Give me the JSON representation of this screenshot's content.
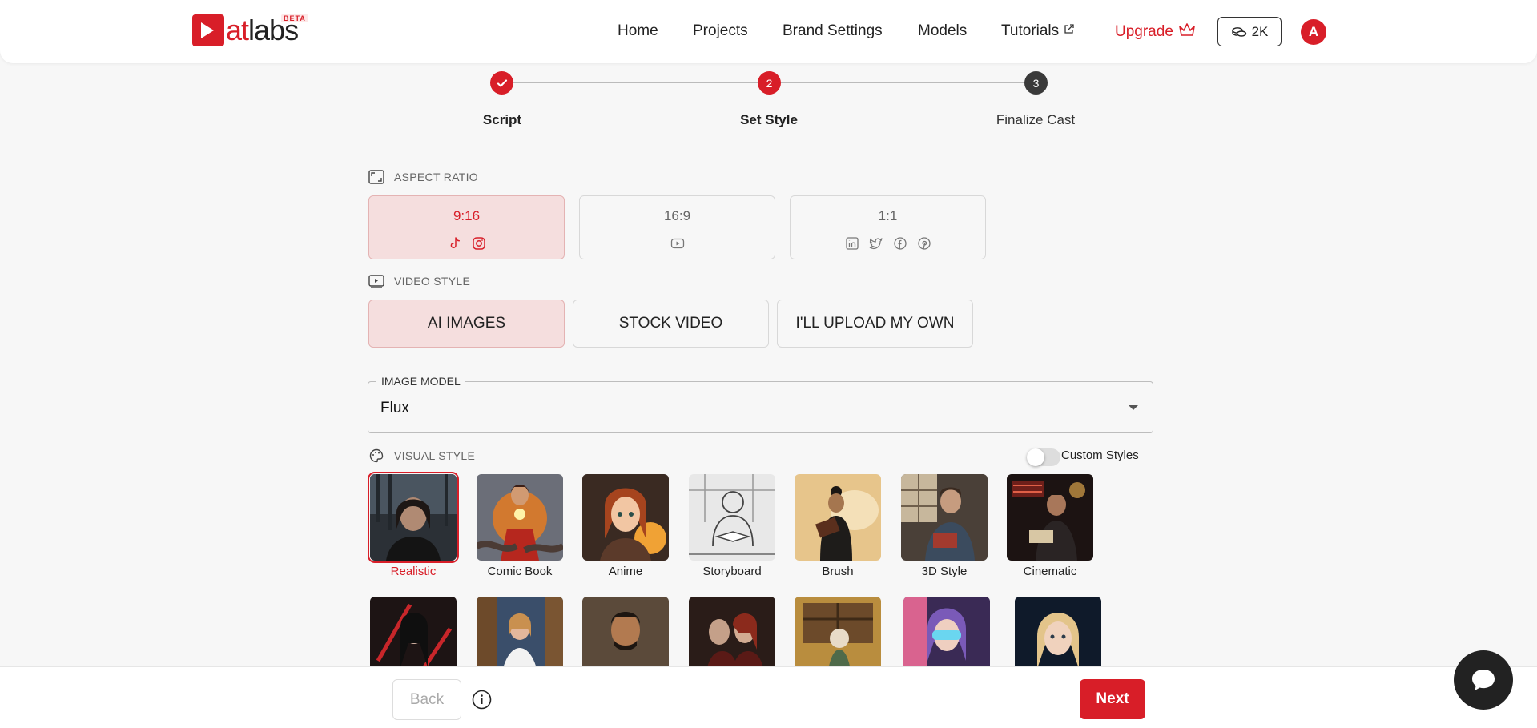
{
  "brand": {
    "logo_text_accent": "at",
    "logo_text_rest": "labs",
    "badge": "BETA",
    "accent_color": "#d81e28"
  },
  "nav": {
    "home": "Home",
    "projects": "Projects",
    "brand_settings": "Brand Settings",
    "models": "Models",
    "tutorials": "Tutorials",
    "upgrade": "Upgrade",
    "credits": "2K",
    "avatar_initial": "A"
  },
  "stepper": {
    "steps": [
      {
        "label": "Script",
        "state": "completed",
        "number": ""
      },
      {
        "label": "Set Style",
        "state": "active",
        "number": "2"
      },
      {
        "label": "Finalize Cast",
        "state": "pending",
        "number": "3"
      }
    ]
  },
  "aspect_ratio": {
    "label": "ASPECT RATIO",
    "options": [
      {
        "value": "9:16",
        "selected": true,
        "icons": [
          "tiktok-icon",
          "instagram-icon"
        ]
      },
      {
        "value": "16:9",
        "selected": false,
        "icons": [
          "youtube-icon"
        ]
      },
      {
        "value": "1:1",
        "selected": false,
        "icons": [
          "linkedin-icon",
          "twitter-icon",
          "facebook-icon",
          "pinterest-icon"
        ]
      }
    ]
  },
  "video_style": {
    "label": "VIDEO STYLE",
    "options": [
      {
        "label": "AI IMAGES",
        "selected": true
      },
      {
        "label": "STOCK VIDEO",
        "selected": false
      },
      {
        "label": "I'LL UPLOAD MY OWN",
        "selected": false
      }
    ]
  },
  "image_model": {
    "label": "IMAGE MODEL",
    "value": "Flux"
  },
  "visual_style": {
    "label": "VISUAL STYLE",
    "custom_styles_label": "Custom Styles",
    "custom_styles_enabled": false,
    "row1": [
      {
        "label": "Realistic",
        "selected": true
      },
      {
        "label": "Comic Book",
        "selected": false
      },
      {
        "label": "Anime",
        "selected": false
      },
      {
        "label": "Storyboard",
        "selected": false
      },
      {
        "label": "Brush",
        "selected": false
      },
      {
        "label": "3D Style",
        "selected": false
      },
      {
        "label": "Cinematic",
        "selected": false
      }
    ]
  },
  "footer": {
    "back": "Back",
    "next": "Next"
  }
}
